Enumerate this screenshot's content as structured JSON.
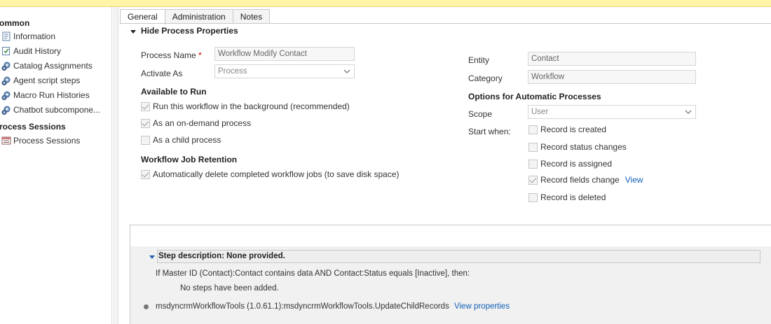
{
  "nav": {
    "section_common": "ommon",
    "items_common": [
      {
        "label": "Information",
        "icon": "info-page-icon"
      },
      {
        "label": "Audit History",
        "icon": "audit-history-icon"
      },
      {
        "label": "Catalog Assignments",
        "icon": "gear-icon"
      },
      {
        "label": "Agent script steps",
        "icon": "gear-icon"
      },
      {
        "label": "Macro Run Histories",
        "icon": "gear-icon"
      },
      {
        "label": "Chatbot subcompone...",
        "icon": "gear-icon"
      }
    ],
    "section_sessions": "rocess Sessions",
    "items_sessions": [
      {
        "label": "Process Sessions",
        "icon": "process-sessions-icon"
      }
    ]
  },
  "tabs": [
    "General",
    "Administration",
    "Notes"
  ],
  "hide_props_label": "Hide Process Properties",
  "left_form": {
    "process_name_label": "Process Name",
    "required_mark": "*",
    "process_name_value": "Workflow Modify Contact",
    "activate_as_label": "Activate As",
    "activate_as_value": "Process",
    "available_heading": "Available to Run",
    "run_background": "Run this workflow in the background (recommended)",
    "on_demand": "As an on-demand process",
    "child_process": "As a child process",
    "retention_heading": "Workflow Job Retention",
    "auto_delete": "Automatically delete completed workflow jobs (to save disk space)"
  },
  "right_form": {
    "entity_label": "Entity",
    "entity_value": "Contact",
    "category_label": "Category",
    "category_value": "Workflow",
    "options_heading": "Options for Automatic Processes",
    "scope_label": "Scope",
    "scope_value": "User",
    "start_when_label": "Start when:",
    "record_created": "Record is created",
    "record_status": "Record status changes",
    "record_assigned": "Record is assigned",
    "record_fields": "Record fields change",
    "view_link": "View",
    "record_deleted": "Record is deleted"
  },
  "steps": {
    "description": "Step description: None provided.",
    "condition": "If Master ID (Contact):Contact contains data AND Contact:Status equals [Inactive], then:",
    "no_steps": "No steps have been added.",
    "action": "msdyncrmWorkflowTools (1.0.61.1):msdyncrmWorkflowTools.UpdateChildRecords",
    "view_properties": "View properties"
  },
  "colors": {
    "banner": "#fff4a8",
    "link": "#1160b7",
    "required": "#c00000"
  }
}
